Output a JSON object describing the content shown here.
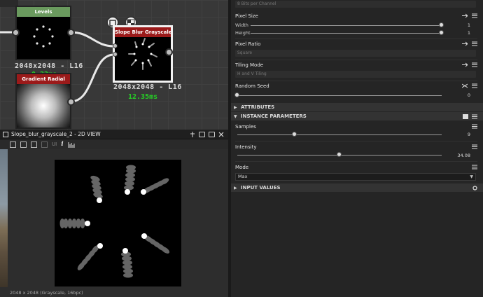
{
  "graph": {
    "levels_node": {
      "title": "Levels",
      "title_color": "#6a9a5e",
      "resolution": "2048x2048 - L16",
      "time": "0.22ms"
    },
    "gradient_node": {
      "title": "Gradient Radial",
      "title_color": "#9b1a1a"
    },
    "slope_node": {
      "title": "Slope Blur Grayscale",
      "title_color": "#9b1a1a",
      "resolution": "2048x2048 - L16",
      "time": "12.35ms"
    },
    "time_color": "#25d025"
  },
  "view2d": {
    "title": "Slope_blur_grayscale_2 - 2D VIEW",
    "toolbar_ui": "UI",
    "toolbar_info": "i",
    "status": "2048 x 2048 (Grayscale, 16bpc)"
  },
  "properties": {
    "output_format_value": "8 Bits per Channel",
    "pixel_size": {
      "label": "Pixel Size",
      "width": {
        "label": "Width",
        "value": "1",
        "fraction": 1.0
      },
      "height": {
        "label": "Height",
        "value": "1",
        "fraction": 1.0
      }
    },
    "pixel_ratio": {
      "label": "Pixel Ratio",
      "value": "Square"
    },
    "tiling_mode": {
      "label": "Tiling Mode",
      "value": "H and V Tiling"
    },
    "random_seed": {
      "label": "Random Seed",
      "value": "0",
      "fraction": 0.0
    },
    "sections": {
      "attributes": "ATTRIBUTES",
      "instance_parameters": "INSTANCE PARAMETERS",
      "input_values": "INPUT VALUES"
    },
    "samples": {
      "label": "Samples",
      "value": "9",
      "fraction": 0.29
    },
    "intensity": {
      "label": "Intensity",
      "value": "34.08",
      "fraction": 0.49
    },
    "mode": {
      "label": "Mode",
      "value": "Max"
    }
  }
}
